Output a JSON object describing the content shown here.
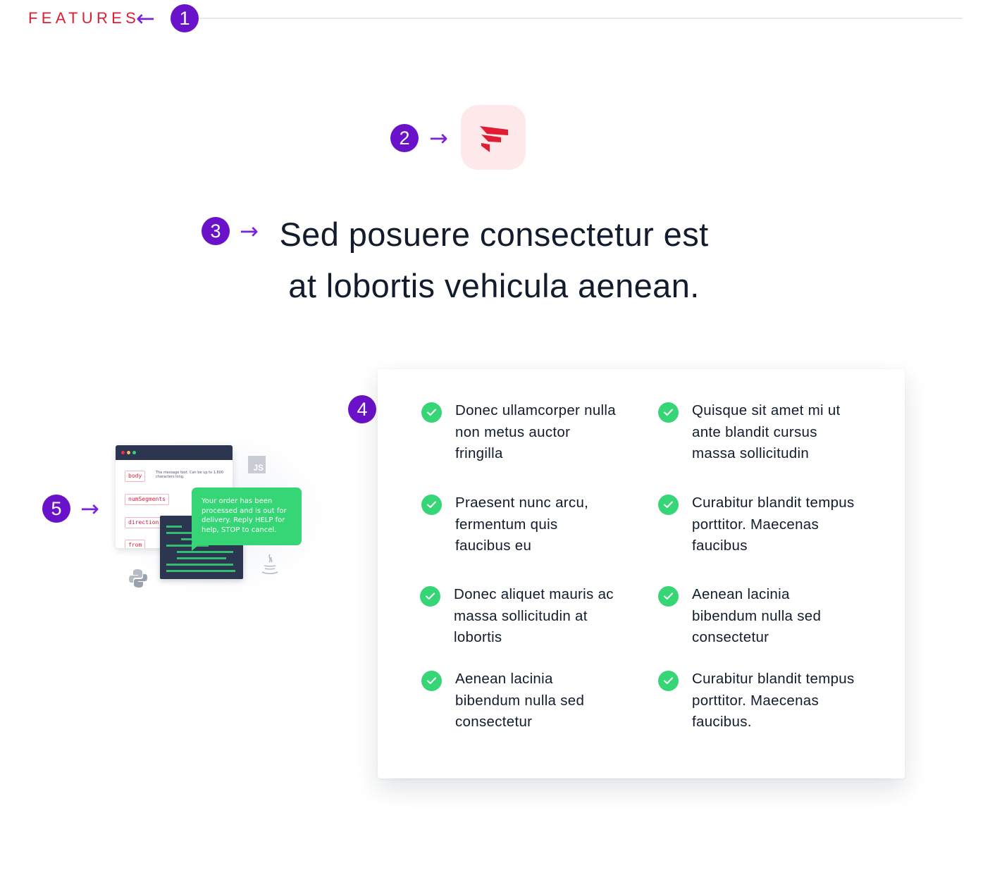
{
  "header": {
    "label": "FEATURES",
    "label_color": "#e11d33"
  },
  "annotations": {
    "markers": [
      "1",
      "2",
      "3",
      "4",
      "5"
    ],
    "arrow_left": "←",
    "arrow_right": "→",
    "marker_color": "#6a12c9"
  },
  "logo": {
    "icon": "brand-logo-icon",
    "tile_color": "#fde8ea",
    "mark_color": "#e11d33"
  },
  "headline": {
    "line1": "Sed posuere consectetur est",
    "line2": "at lobortis vehicula aenean."
  },
  "illustration": {
    "parameters": [
      "body",
      "numSegments",
      "direction",
      "from"
    ],
    "parameter_description": "The message text. Can be up to 1,600 characters long.",
    "js_badge": "JS",
    "sms_message": "Your order has been processed and is out for delivery. Reply HELP for help, STOP to cancel.",
    "icons": [
      "python-icon",
      "java-icon",
      "js-icon"
    ],
    "accent": "#36d576"
  },
  "features": {
    "check_color": "#36d576",
    "items": [
      {
        "lines": [
          "Donec ullamcorper nulla",
          "non metus auctor",
          "fringilla"
        ]
      },
      {
        "lines": [
          "Quisque sit amet mi ut",
          "ante blandit cursus",
          "massa sollicitudin"
        ]
      },
      {
        "lines": [
          "Praesent nunc arcu,",
          "fermentum quis",
          "faucibus eu"
        ]
      },
      {
        "lines": [
          "Curabitur blandit tempus",
          "porttitor. Maecenas",
          "faucibus"
        ]
      },
      {
        "lines": [
          "Donec aliquet mauris ac",
          "massa sollicitudin at",
          "lobortis"
        ]
      },
      {
        "lines": [
          "Aenean lacinia",
          "bibendum nulla sed",
          "consectetur"
        ]
      },
      {
        "lines": [
          "Aenean lacinia",
          "bibendum nulla sed",
          "consectetur"
        ]
      },
      {
        "lines": [
          "Curabitur blandit tempus",
          "porttitor. Maecenas",
          "faucibus."
        ]
      }
    ]
  }
}
